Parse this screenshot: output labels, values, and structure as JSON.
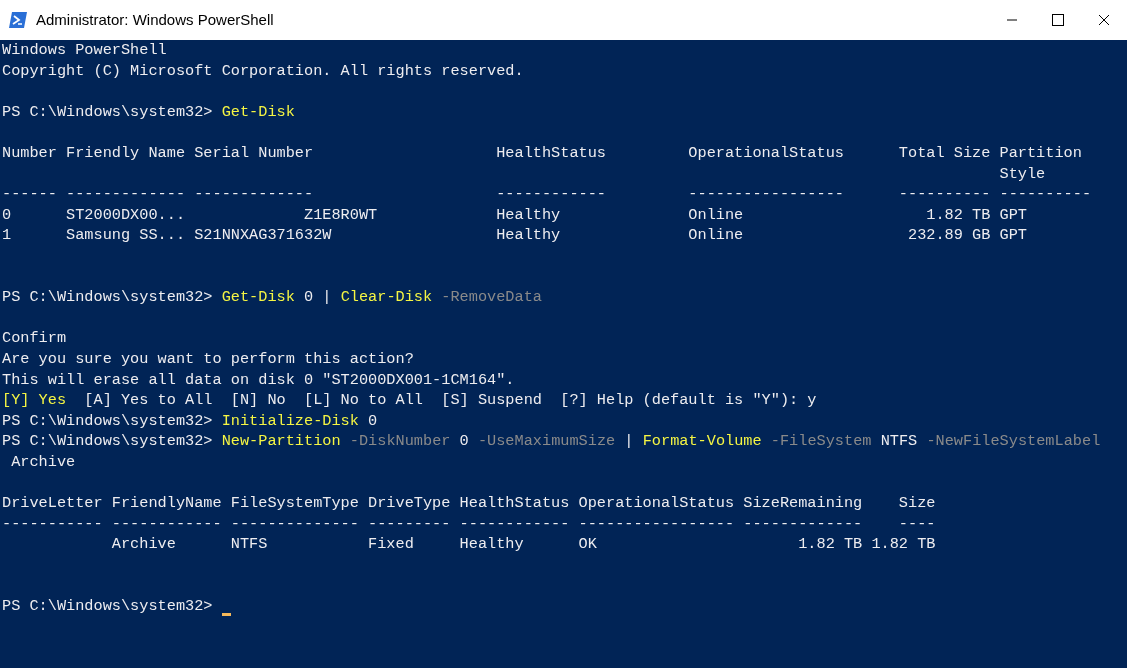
{
  "window": {
    "title": "Administrator: Windows PowerShell"
  },
  "console": {
    "lines": [
      {
        "kind": "text",
        "segments": [
          {
            "kind": "plain",
            "text": "Windows PowerShell"
          }
        ]
      },
      {
        "kind": "text",
        "segments": [
          {
            "kind": "plain",
            "text": "Copyright (C) Microsoft Corporation. All rights reserved."
          }
        ]
      },
      {
        "kind": "blank"
      },
      {
        "kind": "text",
        "segments": [
          {
            "kind": "plain",
            "text": "PS C:\\Windows\\system32> "
          },
          {
            "kind": "command",
            "text": "Get-Disk"
          }
        ]
      },
      {
        "kind": "blank"
      },
      {
        "kind": "text",
        "segments": [
          {
            "kind": "plain",
            "text": "Number Friendly Name Serial Number                    HealthStatus         OperationalStatus      Total Size Partition"
          }
        ]
      },
      {
        "kind": "text",
        "segments": [
          {
            "kind": "plain",
            "text": "                                                                                                             Style"
          }
        ]
      },
      {
        "kind": "text",
        "segments": [
          {
            "kind": "plain",
            "text": "------ ------------- -------------                    ------------         -----------------      ---------- ----------"
          }
        ]
      },
      {
        "kind": "text",
        "segments": [
          {
            "kind": "plain",
            "text": "0      ST2000DX00...             Z1E8R0WT             Healthy              Online                    1.82 TB GPT"
          }
        ]
      },
      {
        "kind": "text",
        "segments": [
          {
            "kind": "plain",
            "text": "1      Samsung SS... S21NNXAG371632W                  Healthy              Online                  232.89 GB GPT"
          }
        ]
      },
      {
        "kind": "blank"
      },
      {
        "kind": "blank"
      },
      {
        "kind": "text",
        "segments": [
          {
            "kind": "plain",
            "text": "PS C:\\Windows\\system32> "
          },
          {
            "kind": "command",
            "text": "Get-Disk"
          },
          {
            "kind": "plain",
            "text": " 0 | "
          },
          {
            "kind": "command",
            "text": "Clear-Disk"
          },
          {
            "kind": "parameter",
            "text": " -RemoveData"
          }
        ]
      },
      {
        "kind": "blank"
      },
      {
        "kind": "text",
        "segments": [
          {
            "kind": "plain",
            "text": "Confirm"
          }
        ]
      },
      {
        "kind": "text",
        "segments": [
          {
            "kind": "plain",
            "text": "Are you sure you want to perform this action?"
          }
        ]
      },
      {
        "kind": "text",
        "segments": [
          {
            "kind": "plain",
            "text": "This will erase all data on disk 0 \"ST2000DX001-1CM164\"."
          }
        ]
      },
      {
        "kind": "text",
        "segments": [
          {
            "kind": "command",
            "text": "[Y] Yes"
          },
          {
            "kind": "plain",
            "text": "  [A] Yes to All  [N] No  [L] No to All  [S] Suspend  [?] Help (default is \"Y\"): y"
          }
        ]
      },
      {
        "kind": "text",
        "segments": [
          {
            "kind": "plain",
            "text": "PS C:\\Windows\\system32> "
          },
          {
            "kind": "command",
            "text": "Initialize-Disk"
          },
          {
            "kind": "plain",
            "text": " 0"
          }
        ]
      },
      {
        "kind": "text",
        "segments": [
          {
            "kind": "plain",
            "text": "PS C:\\Windows\\system32> "
          },
          {
            "kind": "command",
            "text": "New-Partition"
          },
          {
            "kind": "parameter",
            "text": " -DiskNumber"
          },
          {
            "kind": "plain",
            "text": " 0"
          },
          {
            "kind": "parameter",
            "text": " -UseMaximumSize"
          },
          {
            "kind": "plain",
            "text": " | "
          },
          {
            "kind": "command",
            "text": "Format-Volume"
          },
          {
            "kind": "parameter",
            "text": " -FileSystem"
          },
          {
            "kind": "plain",
            "text": " NTFS"
          },
          {
            "kind": "parameter",
            "text": " -NewFileSystemLabel"
          }
        ]
      },
      {
        "kind": "text",
        "segments": [
          {
            "kind": "plain",
            "text": " Archive"
          }
        ]
      },
      {
        "kind": "blank"
      },
      {
        "kind": "text",
        "segments": [
          {
            "kind": "plain",
            "text": "DriveLetter FriendlyName FileSystemType DriveType HealthStatus OperationalStatus SizeRemaining    Size"
          }
        ]
      },
      {
        "kind": "text",
        "segments": [
          {
            "kind": "plain",
            "text": "----------- ------------ -------------- --------- ------------ ----------------- -------------    ----"
          }
        ]
      },
      {
        "kind": "text",
        "segments": [
          {
            "kind": "plain",
            "text": "            Archive      NTFS           Fixed     Healthy      OK                      1.82 TB 1.82 TB"
          }
        ]
      },
      {
        "kind": "blank"
      },
      {
        "kind": "blank"
      },
      {
        "kind": "text",
        "segments": [
          {
            "kind": "plain",
            "text": "PS C:\\Windows\\system32> "
          }
        ]
      }
    ]
  }
}
